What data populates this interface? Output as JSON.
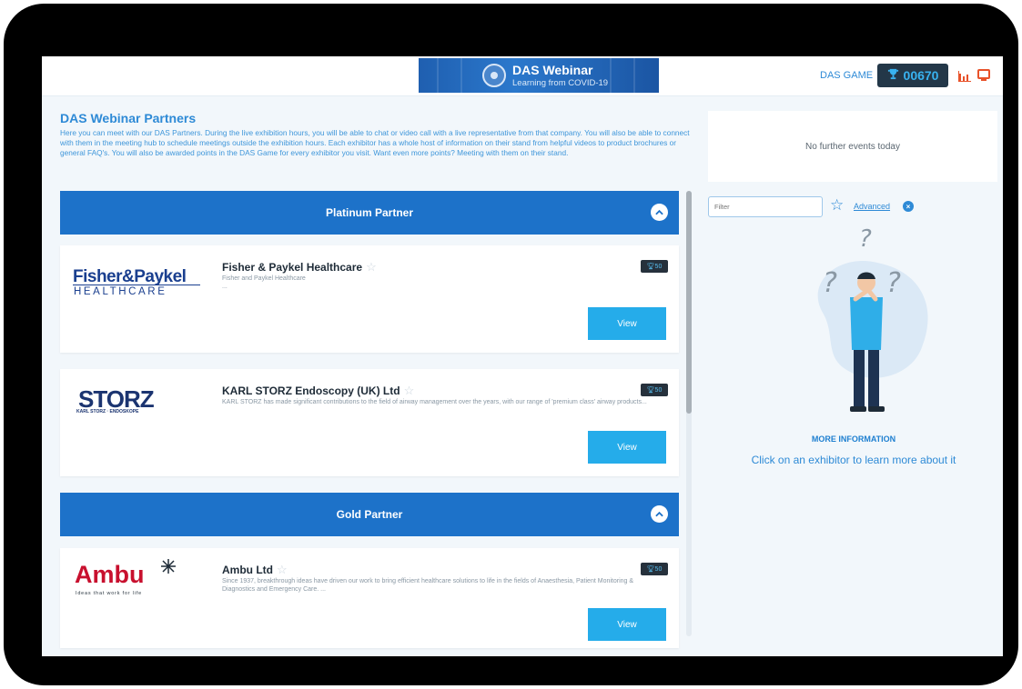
{
  "header": {
    "banner_title": "DAS Webinar",
    "banner_subtitle": "Learning from COVID-19",
    "game_label": "DAS GAME",
    "score": "00670"
  },
  "intro": {
    "title": "DAS Webinar Partners",
    "text": "Here you can meet with our DAS Partners. During the live exhibition hours, you will be able to chat or video call with a live representative from that company. You will also be able to connect with them in the meeting hub to schedule meetings outside the exhibition hours. Each exhibitor has a whole host of information on their stand from helpful videos to product brochures or general FAQ's. You will also be awarded points in the DAS Game for every exhibitor you visit. Want even more points? Meeting with them on their stand."
  },
  "sections": [
    {
      "label": "Platinum Partner"
    },
    {
      "label": "Gold Partner"
    }
  ],
  "exhibitors": [
    {
      "logo_line1": "Fisher&Paykel",
      "logo_line2": "HEALTHCARE",
      "name": "Fisher & Paykel Healthcare",
      "description": "Fisher and Paykel Healthcare",
      "description2": "...",
      "points": "50",
      "view_label": "View"
    },
    {
      "logo_line1": "STORZ",
      "logo_line2": "KARL STORZ · ENDOSKOPE",
      "name": "KARL STORZ Endoscopy (UK) Ltd",
      "description": "KARL STORZ has made significant contributions to the field of airway management over the years, with our range of 'premium class' airway products...",
      "points": "50",
      "view_label": "View"
    },
    {
      "logo_line1": "Ambu",
      "logo_line2": "Ideas that work for life",
      "name": "Ambu Ltd",
      "description": "Since 1937, breakthrough ideas have driven our work to bring efficient healthcare solutions to life in the fields of Anaesthesia, Patient Monitoring & Diagnostics and Emergency Care. ...",
      "points": "50",
      "view_label": "View"
    }
  ],
  "sidebar": {
    "events_text": "No further events today",
    "filter_placeholder": "Filter",
    "advanced_label": "Advanced",
    "more_info_title": "MORE INFORMATION",
    "more_info_text": "Click on an exhibitor to learn more about it"
  },
  "colors": {
    "primary_blue": "#1d72c9",
    "view_button": "#25acea",
    "score_bg": "#233748",
    "fisher_paykel_blue": "#1a3f8f",
    "storz_navy": "#1b3470",
    "ambu_red": "#c8102e"
  }
}
